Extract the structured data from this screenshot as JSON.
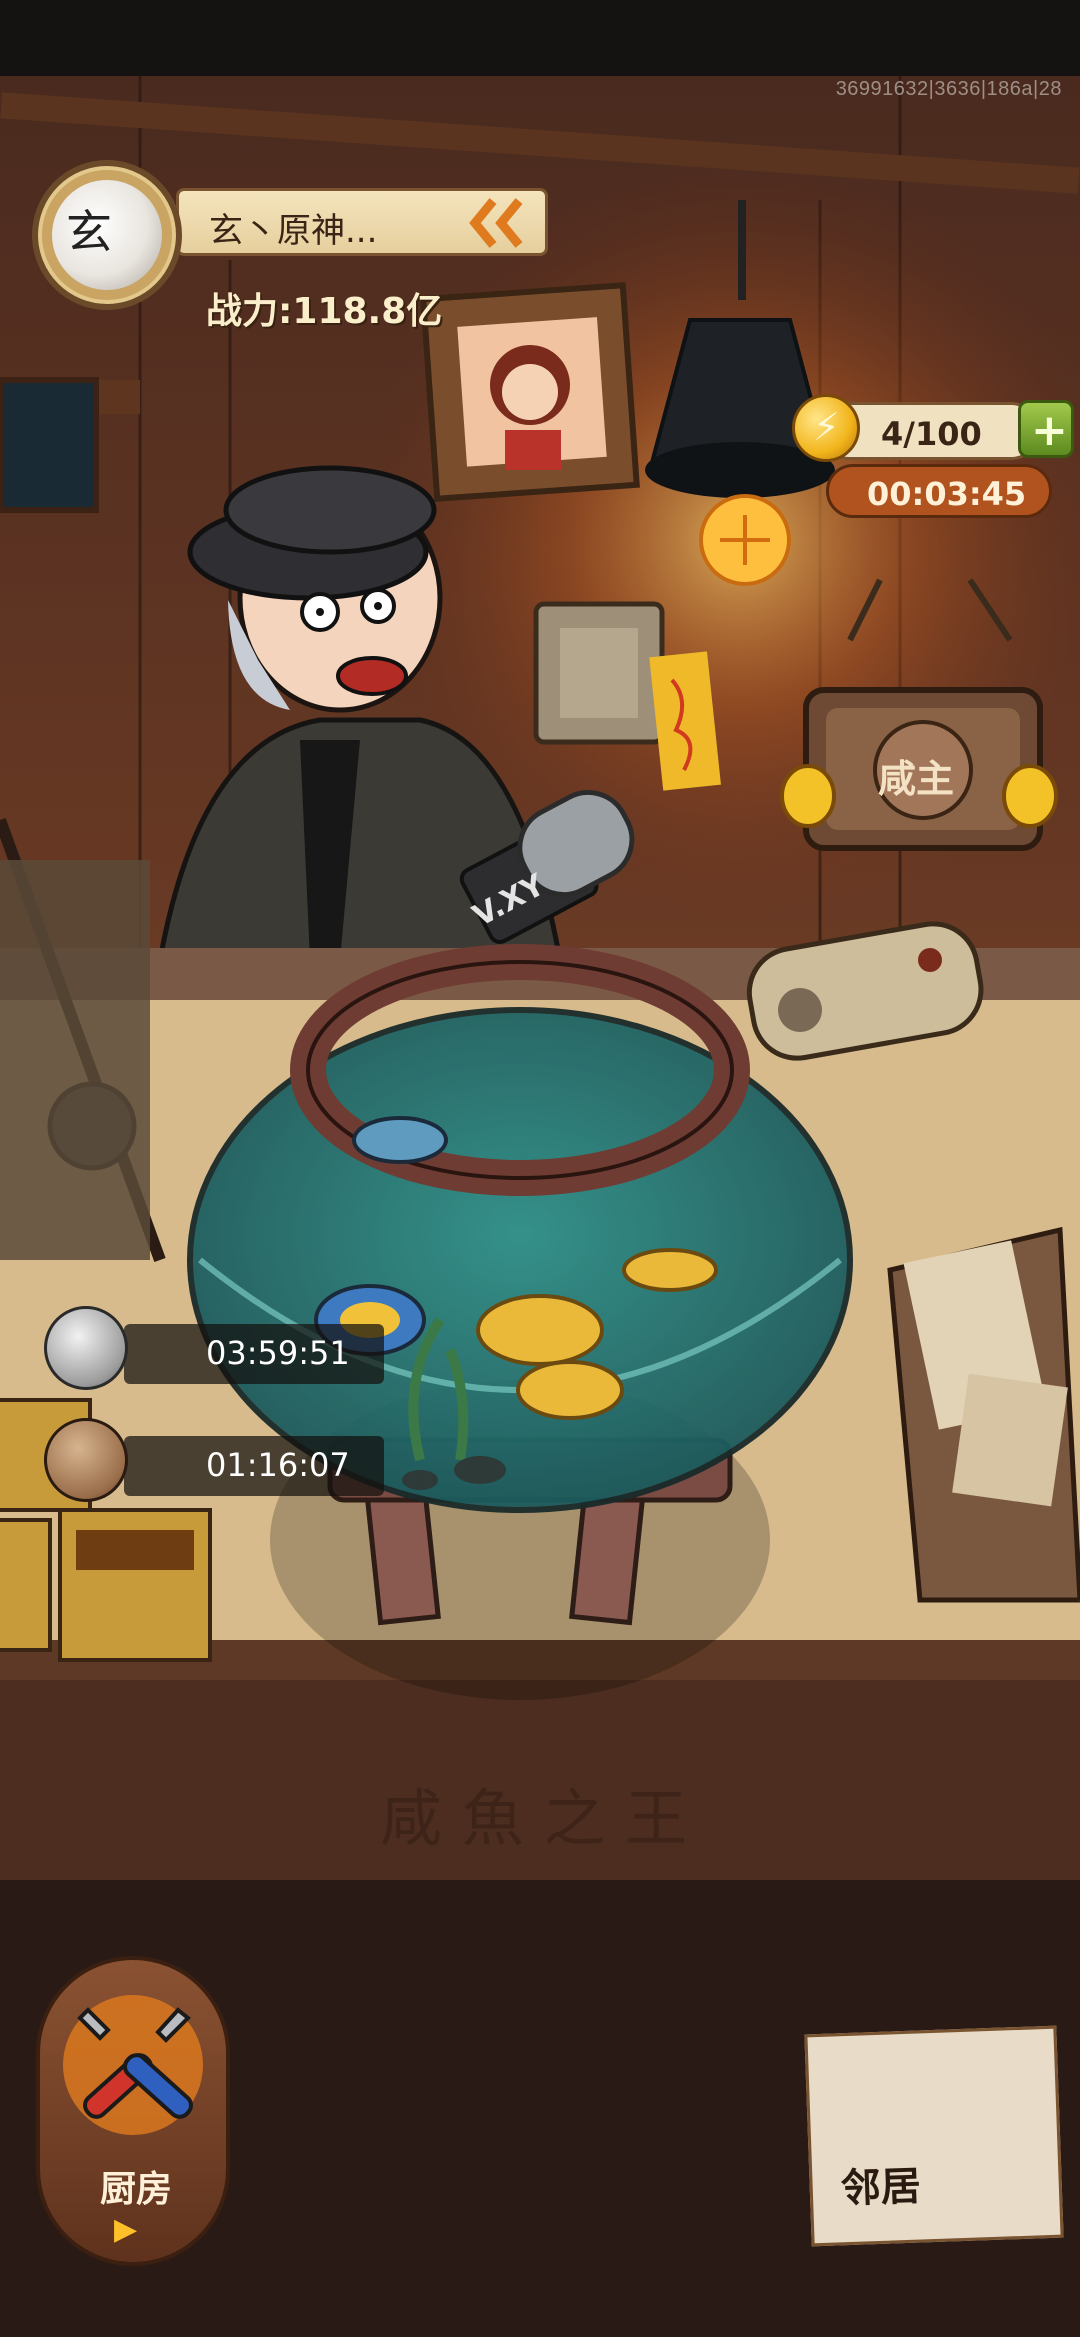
{
  "status": {
    "build_id": "36991632|3636|186a|28"
  },
  "player": {
    "avatar_char": "玄",
    "name": "玄丶原神...",
    "power": "战力:118.8亿"
  },
  "energy": {
    "count": "4/100",
    "timer": "00:03:45"
  },
  "shop": {
    "sign_text": "咸主",
    "mic_text": "V.XY",
    "counter_text": "咸 魚 之 王"
  },
  "brew": {
    "timers": [
      "03:59:51",
      "01:16:07"
    ]
  },
  "nav": {
    "kitchen_label": "厨房",
    "neighbor_label": "邻居"
  },
  "icons": {
    "coin": "lightning-coin-icon",
    "plus": "plus-icon",
    "kitchen": "wrench-tools-icon",
    "neighbor": "neighbor-emblem-icon",
    "pot": "cooking-pot-icon"
  }
}
